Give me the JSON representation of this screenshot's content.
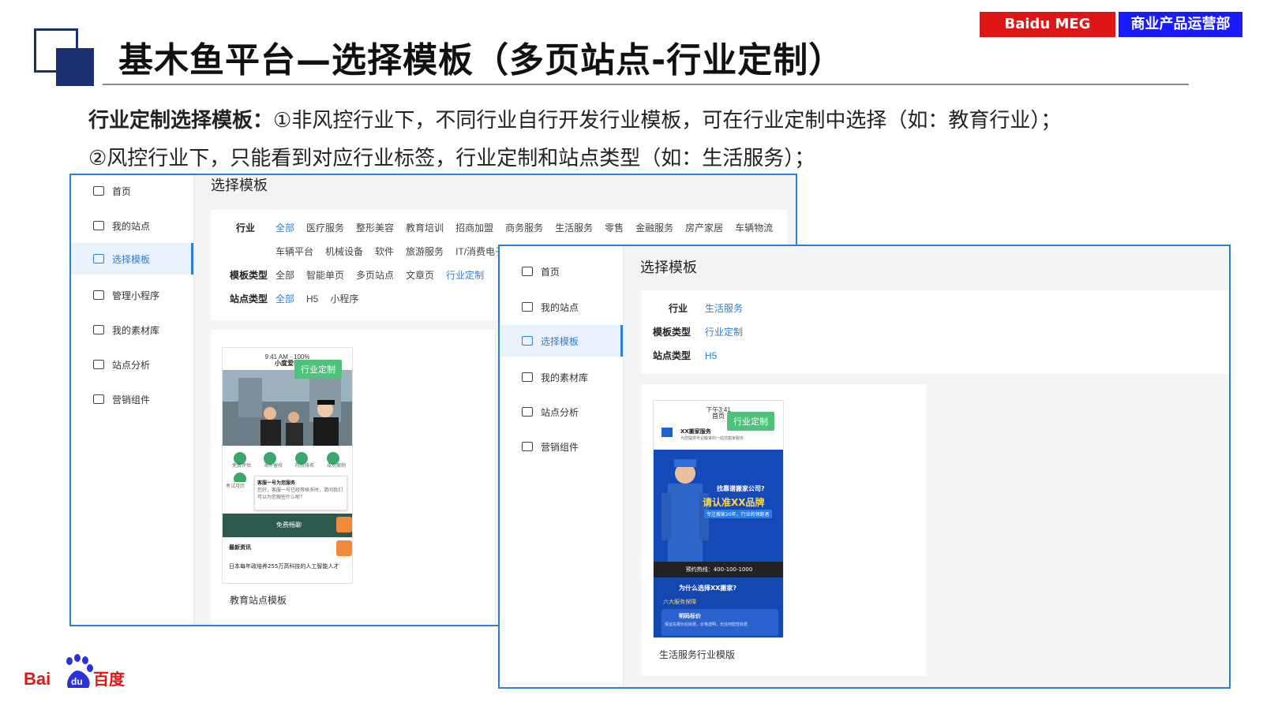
{
  "slide": {
    "title": "基木鱼平台—选择模板（多页站点-行业定制）",
    "tag_left": "Baidu MEG",
    "tag_right": "商业产品运营部",
    "desc_bold": "行业定制选择模板：",
    "desc_line1": "①非风控行业下，不同行业自行开发行业模板，可在行业定制中选择（如：教育行业）；",
    "desc_line2": "②风控行业下，只能看到对应行业标签，行业定制和站点类型（如：生活服务）；",
    "logo_text": "Bai百度"
  },
  "panel_a": {
    "nav": [
      "首页",
      "我的站点",
      "选择模板",
      "管理小程序",
      "我的素材库",
      "站点分析",
      "营销组件"
    ],
    "active_index": 2,
    "page_title": "选择模板",
    "filters": {
      "industry_label": "行业",
      "industry_options": [
        "全部",
        "医疗服务",
        "整形美容",
        "教育培训",
        "招商加盟",
        "商务服务",
        "生活服务",
        "零售",
        "金融服务",
        "房产家居",
        "车辆物流"
      ],
      "industry_options_row2": [
        "车辆平台",
        "机械设备",
        "软件",
        "旅游服务",
        "IT/消费电子"
      ],
      "template_type_label": "模板类型",
      "template_type_options": [
        "全部",
        "智能单页",
        "多页站点",
        "文章页",
        "行业定制"
      ],
      "site_type_label": "站点类型",
      "site_type_options": [
        "全部",
        "H5",
        "小程序"
      ]
    },
    "template": {
      "ribbon": "行业定制",
      "app_name": "小度爱学",
      "time": "9:41 AM",
      "battery": "100%",
      "icons": [
        "免费评估",
        "海外留校",
        "院校排名",
        "成功案例",
        "考试月历"
      ],
      "service_title": "客服一号为您服务",
      "service_text": "您好，客服一号已经等候多时，请问我们可以为您做些什么呢？",
      "banner_text": "免费畅聊",
      "news_title": "最新资讯",
      "news_item": "日本每年政培养255万高科技的人工智能人才",
      "caption": "教育站点模板"
    }
  },
  "panel_b": {
    "nav": [
      "首页",
      "我的站点",
      "选择模板",
      "我的素材库",
      "站点分析",
      "营销组件"
    ],
    "active_index": 2,
    "page_title": "选择模板",
    "filters": {
      "industry_label": "行业",
      "industry_value": "生活服务",
      "template_type_label": "模板类型",
      "template_type_value": "行业定制",
      "site_type_label": "站点类型",
      "site_type_value": "H5"
    },
    "template": {
      "ribbon": "行业定制",
      "time": "下午3:41",
      "header": "首页",
      "company": "XX搬家服务",
      "company_sub": "为您提供专业搬家的一站式搬家服务",
      "hero_line1": "找靠谱搬家公司?",
      "hero_line2": "请认准XX品牌",
      "hero_line3": "专注搬家20年，行业的领跑者",
      "phone_line": "预约热线：400-100-1000",
      "why": "为什么选择XX搬家?",
      "guarantee": "六大服务保障",
      "item1": "明码标价",
      "item1_text": "保证先报价后收费，价格透明，无任何隐性收费",
      "caption": "生活服务行业模版"
    }
  }
}
